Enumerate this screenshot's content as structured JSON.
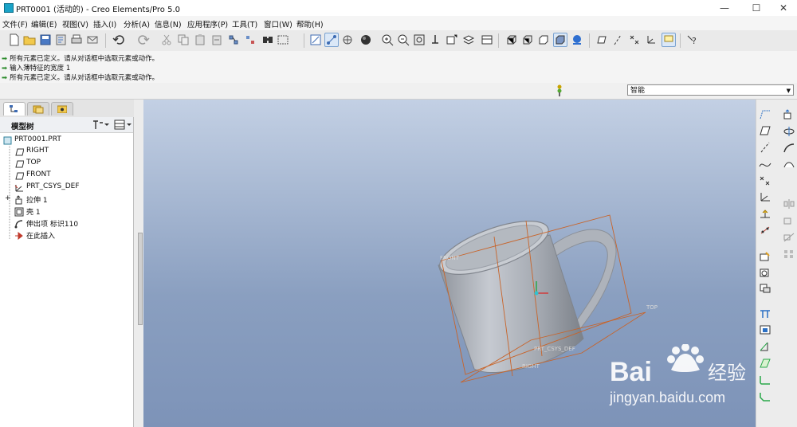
{
  "window": {
    "title": "PRT0001 (活动的) - Creo Elements/Pro 5.0",
    "buttons": {
      "minimize": "—",
      "maximize": "☐",
      "close": "✕"
    }
  },
  "menu": [
    "文件(F)",
    "编辑(E)",
    "视图(V)",
    "插入(I)",
    "分析(A)",
    "信息(N)",
    "应用程序(P)",
    "工具(T)",
    "窗口(W)",
    "帮助(H)"
  ],
  "messages": [
    "所有元素已定义。请从对话框中选取元素或动作。",
    "输入薄特征的宽度  1",
    "所有元素已定义。请从对话框中选取元素或动作。"
  ],
  "filter": {
    "value": "智能"
  },
  "model_tree": {
    "title": "模型树",
    "root": "PRT0001.PRT",
    "items": [
      "RIGHT",
      "TOP",
      "FRONT",
      "PRT_CSYS_DEF",
      "拉伸 1",
      "壳 1",
      "伸出项 标识110",
      "在此插入"
    ]
  },
  "viewport_labels": {
    "front": "FRONT",
    "top": "TOP",
    "csys": "PRT_CSYS_DEF",
    "right": "RIGHT"
  },
  "watermark": {
    "brand": "Bai",
    "brand2": "经验",
    "url": "jingyan.baidu.com"
  },
  "colors": {
    "datum": "#c8642a",
    "background_top": "#c3d0e4",
    "background_bottom": "#7d93b8",
    "mug": "#b9bec6"
  }
}
